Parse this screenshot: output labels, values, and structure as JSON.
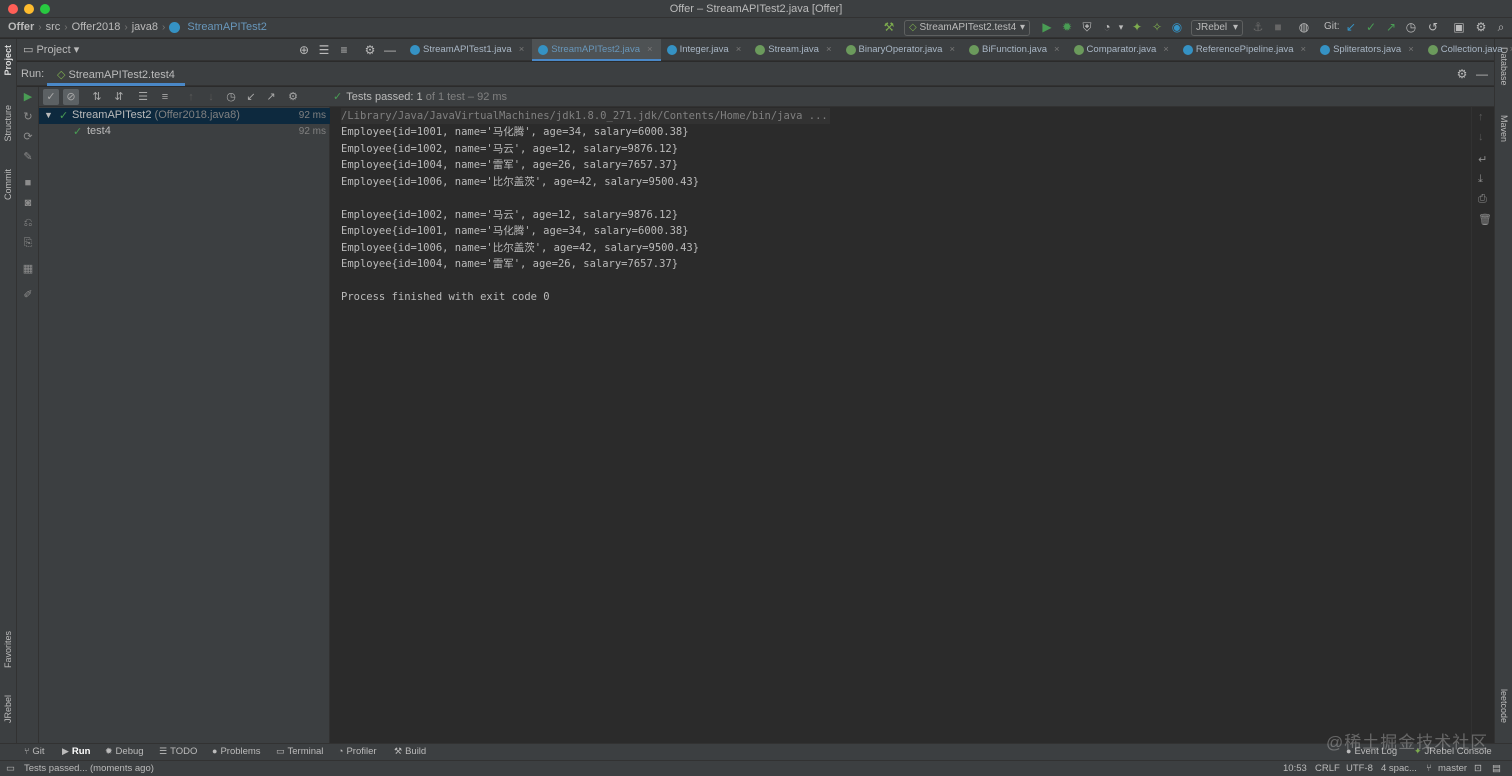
{
  "window": {
    "title": "Offer – StreamAPITest2.java [Offer]"
  },
  "breadcrumbs": [
    "Offer",
    "src",
    "Offer2018",
    "java8",
    "StreamAPITest2"
  ],
  "toolbar": {
    "run_config": "StreamAPITest2.test4",
    "jrebel_select": "JRebel",
    "git_label": "Git:"
  },
  "project_panel": {
    "label": "Project"
  },
  "editor_tabs": [
    {
      "label": "StreamAPITest1.java"
    },
    {
      "label": "StreamAPITest2.java"
    },
    {
      "label": "Integer.java"
    },
    {
      "label": "Stream.java"
    },
    {
      "label": "BinaryOperator.java"
    },
    {
      "label": "BiFunction.java"
    },
    {
      "label": "Comparator.java"
    },
    {
      "label": "ReferencePipeline.java"
    },
    {
      "label": "Spliterators.java"
    },
    {
      "label": "Collection.java"
    }
  ],
  "left_strip": {
    "project": "Project",
    "structure": "Structure",
    "commit": "Commit",
    "favorites": "Favorites",
    "jrebel": "JRebel"
  },
  "right_strip": {
    "database": "Database",
    "maven": "Maven",
    "leetcode": "leetcode"
  },
  "run": {
    "label": "Run:",
    "tab": "StreamAPITest2.test4"
  },
  "tests": {
    "status_bold": "Tests passed: 1",
    "status_dim": " of 1 test – 92 ms"
  },
  "tree": {
    "root_name": "StreamAPITest2",
    "root_pkg": " (Offer2018.java8)",
    "root_time": "92 ms",
    "child_name": "test4",
    "child_time": "92 ms"
  },
  "console": {
    "lines": [
      "/Library/Java/JavaVirtualMachines/jdk1.8.0_271.jdk/Contents/Home/bin/java ...",
      "Employee{id=1001, name='马化腾', age=34, salary=6000.38}",
      "Employee{id=1002, name='马云', age=12, salary=9876.12}",
      "Employee{id=1004, name='雷军', age=26, salary=7657.37}",
      "Employee{id=1006, name='比尔盖茨', age=42, salary=9500.43}",
      "",
      "Employee{id=1002, name='马云', age=12, salary=9876.12}",
      "Employee{id=1001, name='马化腾', age=34, salary=6000.38}",
      "Employee{id=1006, name='比尔盖茨', age=42, salary=9500.43}",
      "Employee{id=1004, name='雷军', age=26, salary=7657.37}",
      "",
      "Process finished with exit code 0"
    ]
  },
  "bottom_tabs": {
    "git": "Git",
    "run": "Run",
    "debug": "Debug",
    "todo": "TODO",
    "problems": "Problems",
    "terminal": "Terminal",
    "profiler": "Profiler",
    "build": "Build",
    "event_log": "Event Log",
    "jrebel_console": "JRebel Console"
  },
  "status": {
    "message": "Tests passed... (moments ago)",
    "time": "10:53",
    "line_sep": "CRLF",
    "encoding": "UTF-8",
    "indent": "4 spac...",
    "branch": "master"
  },
  "watermark": "@稀土掘金技术社区",
  "colors": {
    "accent": "#4a88c7",
    "pass": "#499c54",
    "background": "#2b2b2b",
    "panel": "#3c3f41"
  }
}
